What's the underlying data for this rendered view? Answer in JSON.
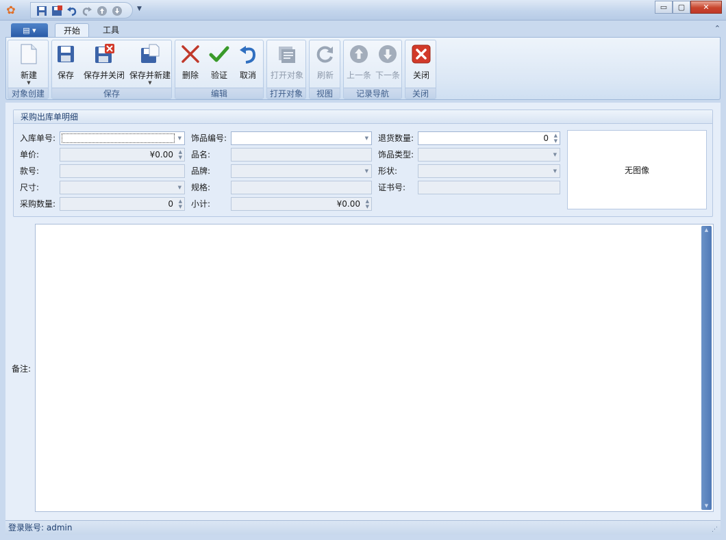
{
  "titlebar": {
    "title": "",
    "quick_access": [
      "save-icon",
      "save-close-icon",
      "undo-icon",
      "redo-icon",
      "up-icon",
      "down-icon"
    ],
    "window_buttons": {
      "minimize": "▭",
      "maximize": "▢",
      "close": "✕"
    }
  },
  "ribbon": {
    "tabs": [
      {
        "label": "开始"
      },
      {
        "label": "工具"
      }
    ],
    "groups": [
      {
        "label": "对象创建",
        "buttons": [
          {
            "label": "新建"
          }
        ]
      },
      {
        "label": "保存",
        "buttons": [
          {
            "label": "保存"
          },
          {
            "label": "保存并关闭"
          },
          {
            "label": "保存并新建"
          }
        ]
      },
      {
        "label": "编辑",
        "buttons": [
          {
            "label": "删除"
          },
          {
            "label": "验证"
          },
          {
            "label": "取消"
          }
        ]
      },
      {
        "label": "打开对象",
        "buttons": [
          {
            "label": "打开对象"
          }
        ]
      },
      {
        "label": "视图",
        "buttons": [
          {
            "label": "刷新"
          }
        ]
      },
      {
        "label": "记录导航",
        "buttons": [
          {
            "label": "上一条"
          },
          {
            "label": "下一条"
          }
        ]
      },
      {
        "label": "关闭",
        "buttons": [
          {
            "label": "关闭"
          }
        ]
      }
    ]
  },
  "form": {
    "panel_title": "采购出库单明细",
    "labels": {
      "inbound_no": "入库单号:",
      "unit_price": "单价:",
      "style_no": "款号:",
      "size": "尺寸:",
      "purchase_qty": "采购数量:",
      "item_code": "饰品编号:",
      "item_name": "品名:",
      "brand": "品牌:",
      "spec": "规格:",
      "subtotal": "小计:",
      "return_qty": "退货数量:",
      "item_type": "饰品类型:",
      "shape": "形状:",
      "cert_no": "证书号:"
    },
    "values": {
      "unit_price": "¥0.00",
      "purchase_qty": "0",
      "subtotal": "¥0.00",
      "return_qty": "0"
    },
    "image_placeholder": "无图像",
    "remark_label": "备注:"
  },
  "statusbar": {
    "login": "登录账号: admin"
  },
  "colors": {
    "accent": "#2a5ba7",
    "panel_bg": "#e3ecf8",
    "delete_red": "#c0392b",
    "verify_green": "#3a9a2a"
  }
}
